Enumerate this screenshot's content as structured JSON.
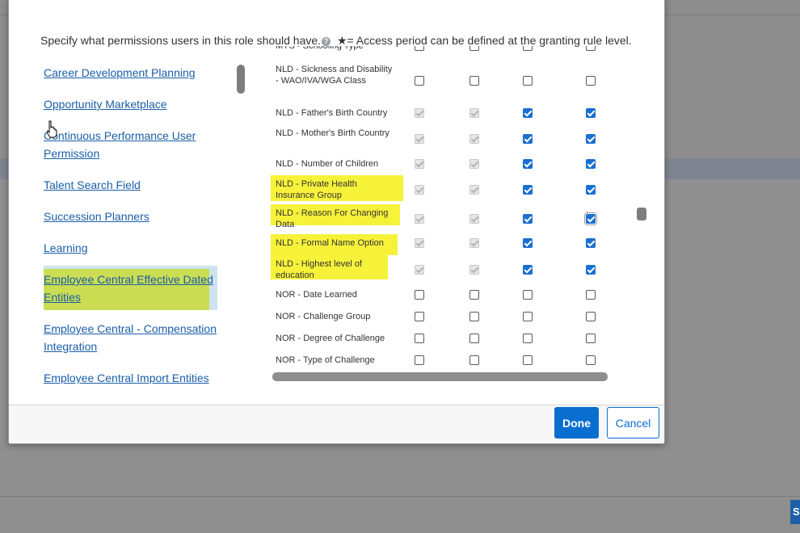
{
  "dialog": {
    "description": "Specify what permissions users in this role should have.",
    "access_note": "★= Access period can be defined at the granting rule level."
  },
  "left_links": [
    {
      "label": "Career Development Planning"
    },
    {
      "label": "Opportunity Marketplace"
    },
    {
      "label": "Continuous Performance User Permission"
    },
    {
      "label": "Talent Search Field"
    },
    {
      "label": "Succession Planners"
    },
    {
      "label": "Learning"
    },
    {
      "label": "Employee Central Effective Dated Entities",
      "highlighted": true
    },
    {
      "label": "Employee Central - Compensation Integration"
    },
    {
      "label": "Employee Central Import Entities"
    }
  ],
  "permission_rows": [
    {
      "label": "MYS - Schooling Type",
      "checks": [
        false,
        false,
        false,
        false
      ],
      "disabled": [
        false,
        false,
        false,
        false
      ]
    },
    {
      "label": "NLD - Sickness and Disability - WAO/IVA/WGA Class",
      "checks": [
        false,
        false,
        false,
        false
      ],
      "disabled": [
        false,
        false,
        false,
        false
      ]
    },
    {
      "label": "NLD - Father's Birth Country",
      "checks": [
        true,
        true,
        true,
        true
      ],
      "disabled": [
        true,
        true,
        false,
        false
      ]
    },
    {
      "label": "NLD - Mother's Birth Country",
      "checks": [
        true,
        true,
        true,
        true
      ],
      "disabled": [
        true,
        true,
        false,
        false
      ]
    },
    {
      "label": "NLD - Number of Children",
      "checks": [
        true,
        true,
        true,
        true
      ],
      "disabled": [
        true,
        true,
        false,
        false
      ]
    },
    {
      "label": "NLD - Private Health Insurance Group",
      "checks": [
        true,
        true,
        true,
        true
      ],
      "disabled": [
        true,
        true,
        false,
        false
      ],
      "highlighted": true
    },
    {
      "label": "NLD - Reason For Changing Data",
      "checks": [
        true,
        true,
        true,
        true
      ],
      "disabled": [
        true,
        true,
        false,
        false
      ],
      "highlighted": true
    },
    {
      "label": "NLD - Formal Name Option",
      "checks": [
        true,
        true,
        true,
        true
      ],
      "disabled": [
        true,
        true,
        false,
        false
      ],
      "highlighted": true
    },
    {
      "label": "NLD - Highest level of education",
      "checks": [
        true,
        true,
        true,
        true
      ],
      "disabled": [
        true,
        true,
        false,
        false
      ],
      "highlighted": true
    },
    {
      "label": "NOR - Date Learned",
      "checks": [
        false,
        false,
        false,
        false
      ],
      "disabled": [
        false,
        false,
        false,
        false
      ]
    },
    {
      "label": "NOR - Challenge Group",
      "checks": [
        false,
        false,
        false,
        false
      ],
      "disabled": [
        false,
        false,
        false,
        false
      ]
    },
    {
      "label": "NOR - Degree of Challenge",
      "checks": [
        false,
        false,
        false,
        false
      ],
      "disabled": [
        false,
        false,
        false,
        false
      ]
    },
    {
      "label": "NOR - Type of Challenge",
      "checks": [
        false,
        false,
        false,
        false
      ],
      "disabled": [
        false,
        false,
        false,
        false
      ]
    }
  ],
  "footer": {
    "done_label": "Done",
    "cancel_label": "Cancel"
  },
  "colors": {
    "accent": "#0a6ed1",
    "link": "#1a5ea8",
    "highlight_yellow": "#f6f23a",
    "highlight_green": "#cbdd52"
  }
}
